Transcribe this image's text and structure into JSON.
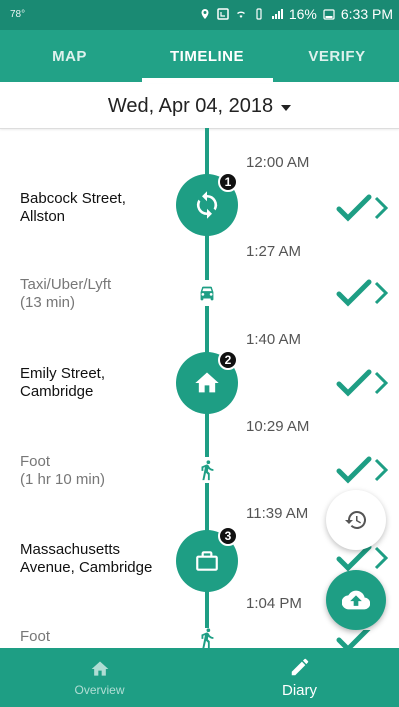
{
  "status_bar": {
    "left_text": "78°",
    "battery": "16%",
    "time": "6:33 PM"
  },
  "top_tabs": [
    {
      "label": "MAP",
      "active": false
    },
    {
      "label": "TIMELINE",
      "active": true
    },
    {
      "label": "VERIFY",
      "active": false
    }
  ],
  "date": "Wed, Apr 04, 2018",
  "timeline": {
    "places": [
      {
        "badge": "1",
        "label": "Babcock Street, Allston",
        "start": "12:00 AM",
        "end": "1:27 AM",
        "icon": "sync-icon"
      },
      {
        "badge": "2",
        "label": "Emily Street, Cambridge",
        "start": "1:40 AM",
        "end": "10:29 AM",
        "icon": "home-icon"
      },
      {
        "badge": "3",
        "label": "Massachusetts Avenue, Cambridge",
        "start": "11:39 AM",
        "end": "1:04 PM",
        "icon": "briefcase-icon"
      }
    ],
    "trips": [
      {
        "label": "Taxi/Uber/Lyft",
        "duration": "(13 min)",
        "icon": "taxi-icon"
      },
      {
        "label": "Foot",
        "duration": "(1 hr 10 min)",
        "icon": "walk-icon"
      },
      {
        "label": "Foot",
        "duration": "",
        "icon": "walk-icon"
      }
    ]
  },
  "bottom_nav": [
    {
      "label": "Overview",
      "icon": "home-icon",
      "active": false
    },
    {
      "label": "Diary",
      "icon": "pencil-icon",
      "active": true
    }
  ],
  "colors": {
    "primary": "#22a287",
    "dark": "#1a8a73",
    "accent_check": "#1e9e84"
  }
}
